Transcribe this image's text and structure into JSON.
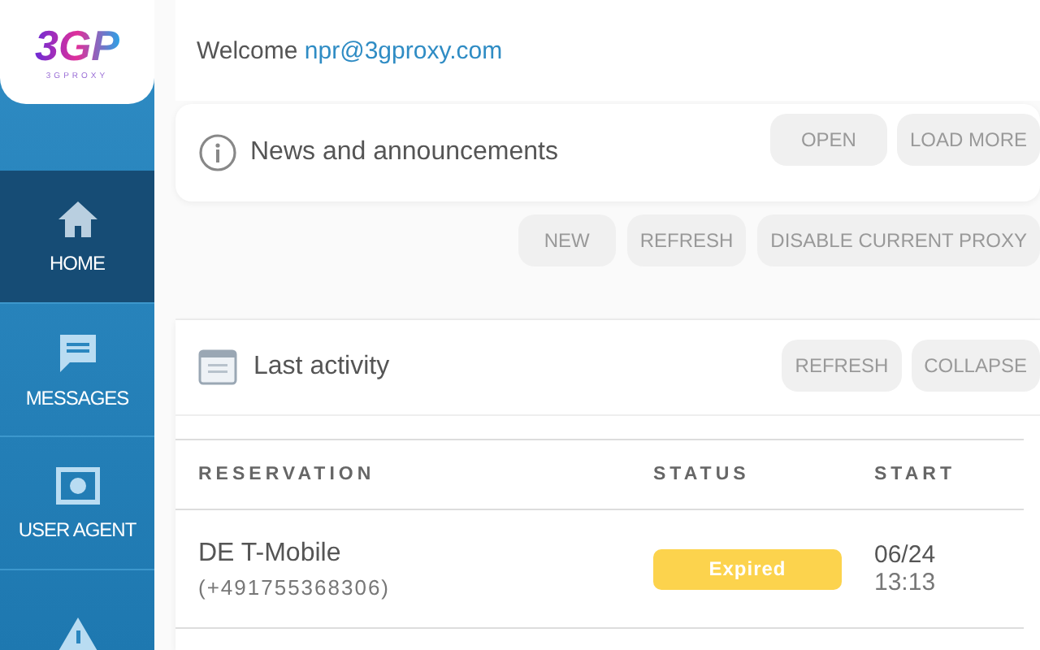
{
  "logo": {
    "mark": "3GP",
    "wordmark": "3GPROXY"
  },
  "sidebar": {
    "items": [
      {
        "kind": "home",
        "label": "HOME",
        "selected": true
      },
      {
        "kind": "message",
        "label": "MESSAGES",
        "selected": false
      },
      {
        "kind": "agent",
        "label": "USER AGENT",
        "selected": false
      },
      {
        "kind": "warning",
        "selected": false
      }
    ]
  },
  "welcome": {
    "text": "Welcome",
    "email": "npr@3gproxy.com"
  },
  "news": {
    "title": "News and announcements",
    "buttons": [
      "OPEN",
      "LOAD MORE"
    ]
  },
  "actions": [
    "NEW",
    "REFRESH",
    "DISABLE CURRENT PROXY"
  ],
  "activity": {
    "title": "Last activity",
    "buttons": [
      "REFRESH",
      "COLLAPSE"
    ],
    "table": {
      "columns": [
        "RESERVATION",
        "STATUS",
        "START"
      ],
      "rows": [
        {
          "reservation": "DE T-Mobile",
          "phone": "(+491755368306)",
          "status": "Expired",
          "kind": "expired",
          "date": "06/24",
          "time": "13:13"
        }
      ]
    }
  }
}
